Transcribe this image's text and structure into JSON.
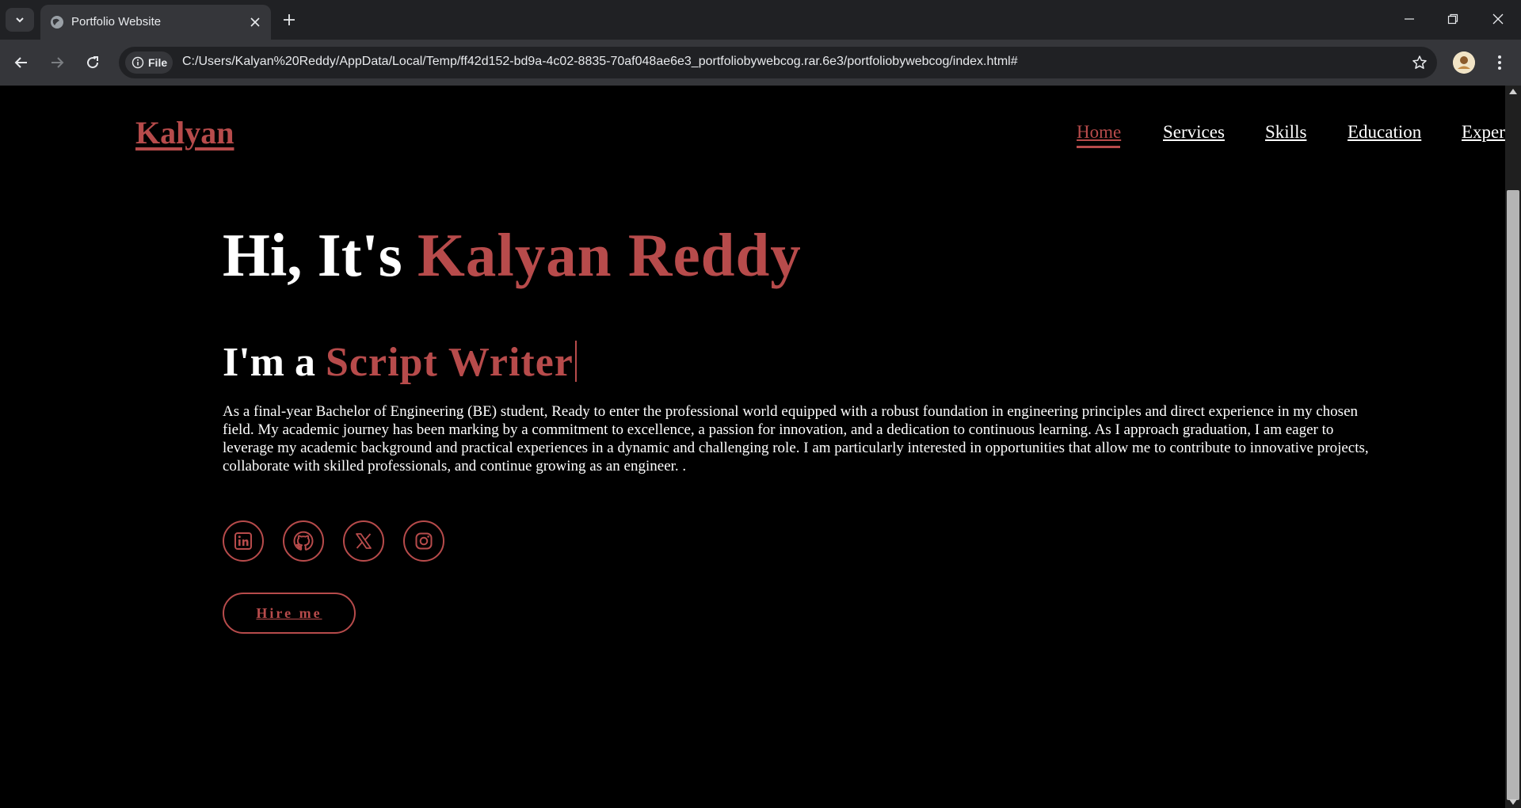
{
  "browser": {
    "tab_title": "Portfolio Website",
    "site_chip_label": "File",
    "url": "C:/Users/Kalyan%20Reddy/AppData/Local/Temp/ff42d152-bd9a-4c02-8835-70af048ae6e3_portfoliobywebcog.rar.6e3/portfoliobywebcog/index.html#"
  },
  "header": {
    "logo": "Kalyan",
    "nav": [
      {
        "label": "Home",
        "active": true
      },
      {
        "label": "Services",
        "active": false
      },
      {
        "label": "Skills",
        "active": false
      },
      {
        "label": "Education",
        "active": false
      },
      {
        "label": "Exper",
        "active": false
      }
    ]
  },
  "hero": {
    "greeting": "Hi, It's ",
    "name": "Kalyan Reddy",
    "role_prefix": "I'm a ",
    "role": "Script Writer",
    "description": "As a final-year Bachelor of Engineering (BE) student, Ready to enter the professional world equipped with a robust foundation in engineering principles and direct experience in my chosen field. My academic journey has been marking by a commitment to excellence, a passion for innovation, and a dedication to continuous learning. As I approach graduation, I am eager to leverage my academic background and practical experiences in a dynamic and challenging role. I am particularly interested in opportunities that allow me to contribute to innovative projects, collaborate with skilled professionals, and continue growing as an engineer. .",
    "socials": [
      "linkedin-icon",
      "github-icon",
      "x-icon",
      "instagram-icon"
    ],
    "hire_label": "Hire me"
  },
  "colors": {
    "accent": "#b74b4b",
    "background": "#000000",
    "text": "#ffffff"
  }
}
